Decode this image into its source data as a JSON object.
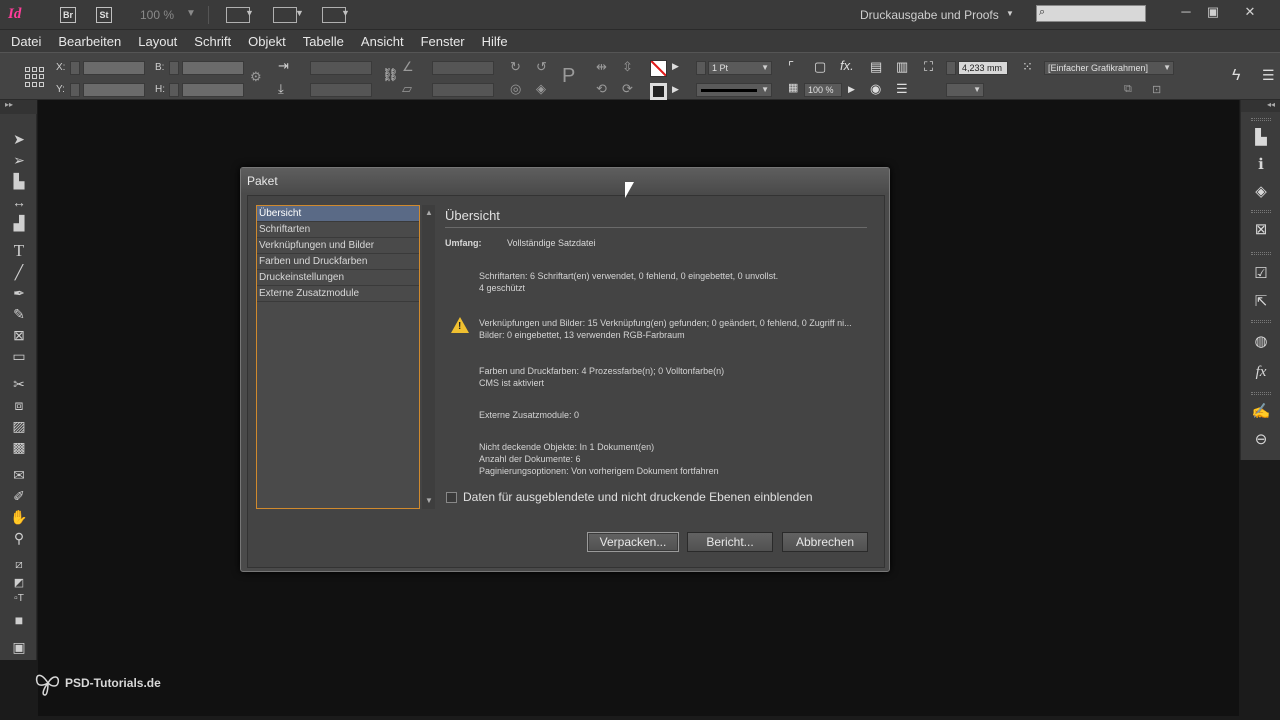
{
  "app": {
    "logo": "Id",
    "bridge_icon": "Br",
    "stock_icon": "St",
    "zoom": "100 %",
    "workspace": "Druckausgabe und Proofs",
    "search_placeholder": ""
  },
  "menu": [
    "Datei",
    "Bearbeiten",
    "Layout",
    "Schrift",
    "Objekt",
    "Tabelle",
    "Ansicht",
    "Fenster",
    "Hilfe"
  ],
  "controlbar": {
    "x_label": "X:",
    "y_label": "Y:",
    "b_label": "B:",
    "h_label": "H:",
    "stroke_weight": "1 Pt",
    "opacity": "100 %",
    "size_value": "4,233 mm",
    "object_style": "[Einfacher Grafikrahmen]"
  },
  "dialog": {
    "title": "Paket",
    "categories": [
      "Übersicht",
      "Schriftarten",
      "Verknüpfungen und Bilder",
      "Farben und Druckfarben",
      "Druckeinstellungen",
      "Externe Zusatzmodule"
    ],
    "section_title": "Übersicht",
    "umfang_label": "Umfang:",
    "umfang_value": "Vollständige Satzdatei",
    "fonts_line1": "Schriftarten: 6 Schriftart(en) verwendet, 0 fehlend, 0 eingebettet, 0 unvollst.",
    "fonts_line2": "4 geschützt",
    "links_line1": "Verknüpfungen und Bilder: 15 Verknüpfung(en) gefunden; 0 geändert, 0 fehlend, 0 Zugriff ni...",
    "links_line2": "Bilder: 0 eingebettet, 13 verwenden RGB-Farbraum",
    "colors_line1": "Farben und Druckfarben: 4 Prozessfarbe(n); 0 Volltonfarbe(n)",
    "colors_line2": "CMS ist aktiviert",
    "plugins_line": "Externe Zusatzmodule: 0",
    "opaque_line": "Nicht deckende Objekte: In 1 Dokument(en)",
    "docs_line": "Anzahl der Dokumente: 6",
    "pagination_line": "Paginierungsoptionen: Von vorherigem Dokument fortfahren",
    "checkbox_label": "Daten für ausgeblendete und nicht druckende Ebenen einblenden",
    "checkbox_checked": false,
    "btn_package": "Verpacken...",
    "btn_report": "Bericht...",
    "btn_cancel": "Abbrechen"
  },
  "watermark": "PSD-Tutorials.de"
}
